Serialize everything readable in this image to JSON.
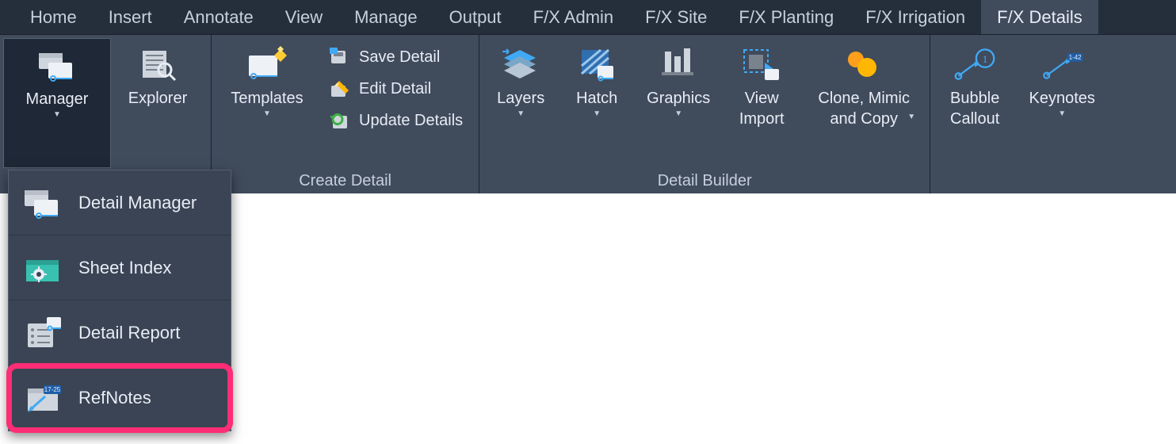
{
  "tabs": [
    {
      "label": "Home"
    },
    {
      "label": "Insert"
    },
    {
      "label": "Annotate"
    },
    {
      "label": "View"
    },
    {
      "label": "Manage"
    },
    {
      "label": "Output"
    },
    {
      "label": "F/X Admin"
    },
    {
      "label": "F/X Site"
    },
    {
      "label": "F/X Planting"
    },
    {
      "label": "F/X Irrigation"
    },
    {
      "label": "F/X Details",
      "active": true
    }
  ],
  "ribbon": {
    "manager": {
      "label": "Manager",
      "open": true
    },
    "explorer": {
      "label": "Explorer"
    },
    "templates": {
      "label": "Templates"
    },
    "small": {
      "save": "Save Detail",
      "edit": "Edit Detail",
      "update": "Update Details"
    },
    "layers": {
      "label": "Layers"
    },
    "hatch": {
      "label": "Hatch"
    },
    "graphics": {
      "label": "Graphics"
    },
    "view_import": {
      "label_top": "View",
      "label_bot": "Import"
    },
    "clone": {
      "label_top": "Clone, Mimic",
      "label_bot": "and Copy"
    },
    "bubble": {
      "label_top": "Bubble",
      "label_bot": "Callout"
    },
    "keynotes": {
      "label": "Keynotes"
    },
    "group_labels": {
      "create_detail": "Create Detail",
      "detail_builder": "Detail Builder"
    }
  },
  "dropdown": {
    "items": [
      {
        "label": "Detail Manager",
        "icon": "folder-detail-icon"
      },
      {
        "label": "Sheet Index",
        "icon": "folder-gear-icon"
      },
      {
        "label": "Detail Report",
        "icon": "report-icon"
      },
      {
        "label": "RefNotes",
        "icon": "refnotes-icon",
        "highlighted": true
      }
    ]
  }
}
